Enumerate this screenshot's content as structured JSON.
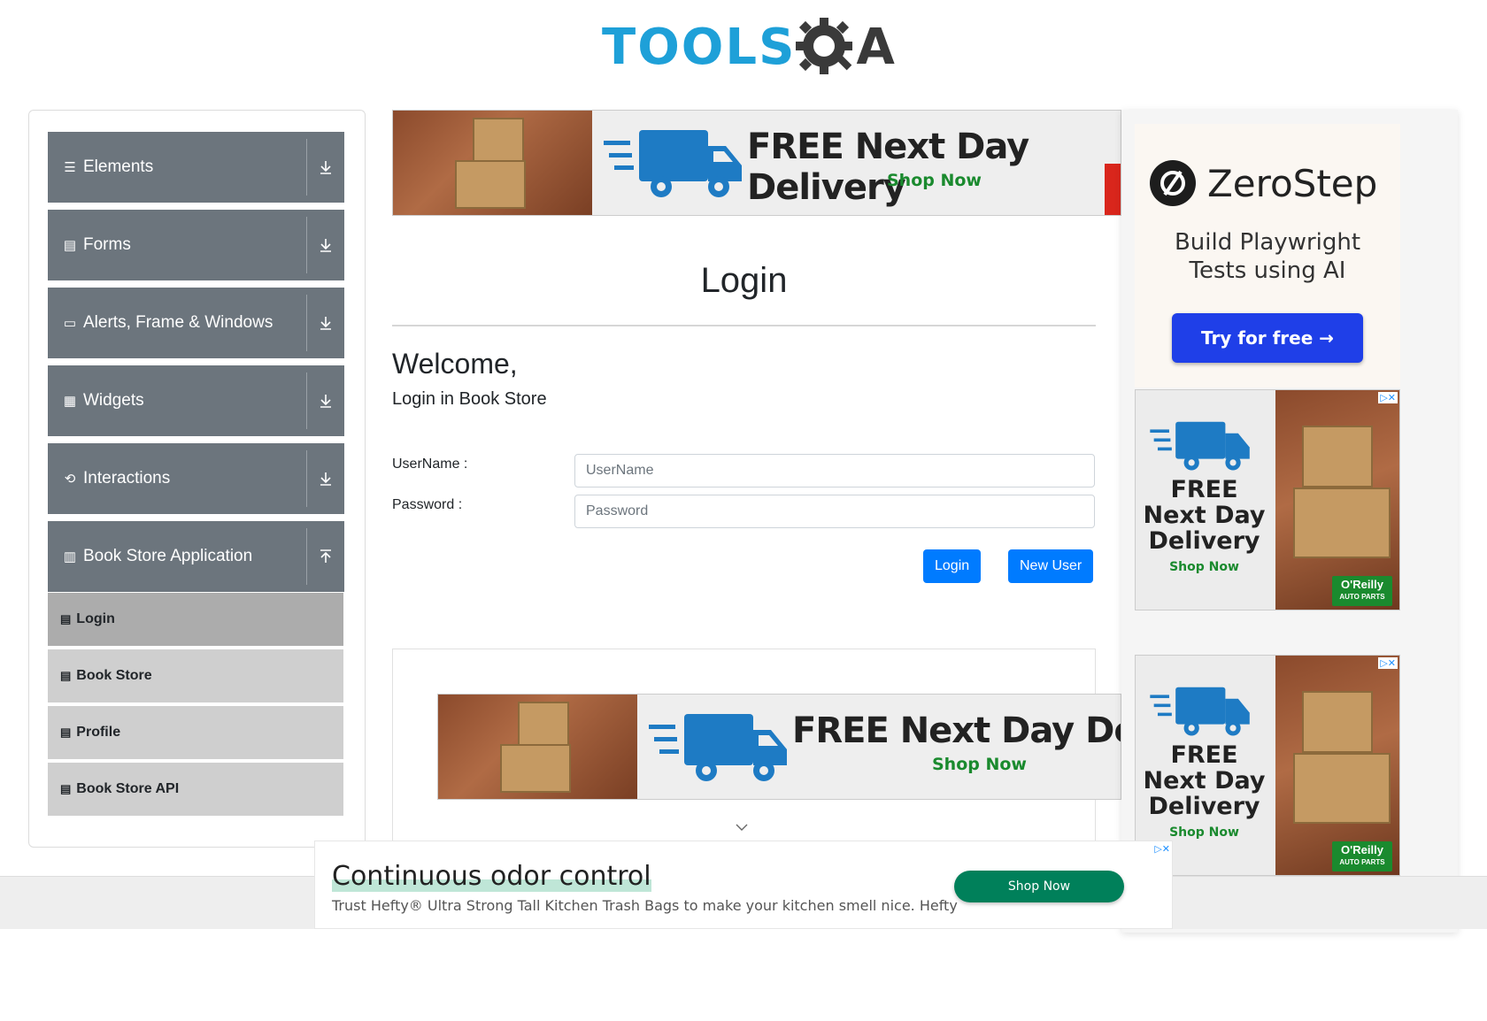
{
  "header": {
    "logo_part1": "TOOLS",
    "logo_part2": "A"
  },
  "sidebar": {
    "groups": [
      {
        "label": "Elements",
        "icon": "hamburger-icon"
      },
      {
        "label": "Forms",
        "icon": "document-icon"
      },
      {
        "label": "Alerts, Frame & Windows",
        "icon": "window-icon"
      },
      {
        "label": "Widgets",
        "icon": "widgets-icon"
      },
      {
        "label": "Interactions",
        "icon": "interactions-icon"
      },
      {
        "label": "Book Store Application",
        "icon": "books-icon"
      }
    ],
    "book_store_items": [
      {
        "label": "Login",
        "active": true
      },
      {
        "label": "Book Store",
        "active": false
      },
      {
        "label": "Profile",
        "active": false
      },
      {
        "label": "Book Store API",
        "active": false
      }
    ]
  },
  "banner_ad": {
    "headline": "FREE Next Day Delivery",
    "cta": "Shop Now"
  },
  "main": {
    "title": "Login",
    "welcome": "Welcome,",
    "subtitle": "Login in Book Store",
    "username_label": "UserName :",
    "username_placeholder": "UserName",
    "password_label": "Password :",
    "password_placeholder": "Password",
    "login_button": "Login",
    "new_user_button": "New User"
  },
  "lower_ad": {
    "headline": "FREE Next Day Deliver",
    "cta": "Shop Now"
  },
  "right_ads": {
    "zerostep": {
      "name": "ZeroStep",
      "text_line1": "Build Playwright",
      "text_line2": "Tests using AI",
      "cta": "Try for free →"
    },
    "delivery": {
      "line1": "FREE",
      "line2": "Next Day",
      "line3": "Delivery",
      "cta": "Shop Now",
      "brand": "O'Reilly",
      "brand_sub": "AUTO PARTS"
    }
  },
  "bottom_ad": {
    "headline": "Continuous odor control",
    "description": "Trust Hefty® Ultra Strong Tall Kitchen Trash Bags to make your kitchen smell nice. Hefty",
    "cta": "Shop Now"
  },
  "colors": {
    "sidebar_header": "#6c757d",
    "submenu": "#cfcfcf",
    "submenu_active": "#acacac",
    "primary": "#007bff",
    "logo_blue": "#1ea0d8"
  }
}
